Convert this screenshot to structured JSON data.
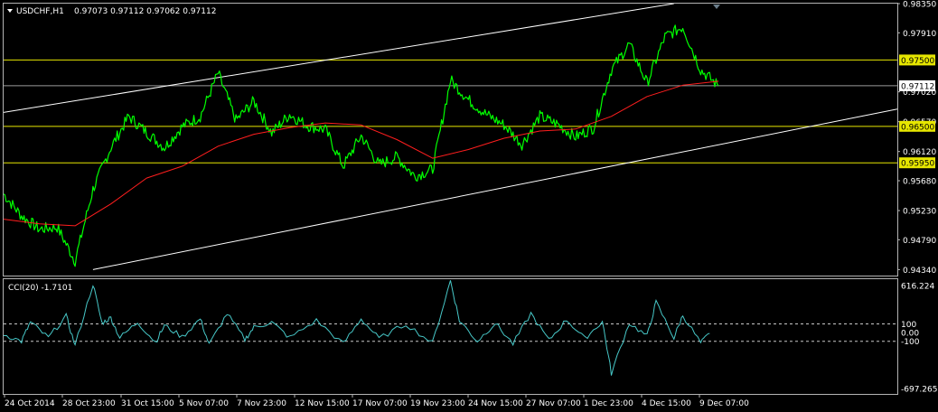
{
  "chart_data": [
    {
      "type": "line",
      "title": "USDCHF,H1",
      "ohlc_label": "0.97073 0.97112 0.97062 0.97112",
      "symbol_bar_icon": "triangle-down-icon",
      "ylim": [
        0.9425,
        0.9835
      ],
      "y_ticks": [
        "0.98350",
        "0.97910",
        "0.97020",
        "0.96570",
        "0.96120",
        "0.95680",
        "0.95230",
        "0.94790",
        "0.94340"
      ],
      "y_tick_values": [
        0.9835,
        0.9791,
        0.9702,
        0.9657,
        0.9612,
        0.9568,
        0.9523,
        0.9479,
        0.9434
      ],
      "x_ticks": [
        "24 Oct 2014",
        "28 Oct 23:00",
        "31 Oct 15:00",
        "5 Nov 07:00",
        "7 Nov 23:00",
        "12 Nov 15:00",
        "17 Nov 07:00",
        "19 Nov 23:00",
        "24 Nov 15:00",
        "27 Nov 07:00",
        "1 Dec 23:00",
        "4 Dec 15:00",
        "9 Dec 07:00"
      ],
      "x_range": [
        0,
        100
      ],
      "current_price_label": "0.97112",
      "current_price": 0.97112,
      "levels": [
        {
          "label": "0.97500",
          "value": 0.975
        },
        {
          "label": "0.96500",
          "value": 0.965
        },
        {
          "label": "0.95950",
          "value": 0.9595
        }
      ],
      "channel": [
        {
          "name": "upper",
          "x": [
            0,
            75
          ],
          "y": [
            0.9671,
            0.9835
          ]
        },
        {
          "name": "lower",
          "x": [
            10,
            100
          ],
          "y": [
            0.9434,
            0.9676
          ]
        }
      ],
      "series": [
        {
          "role": "price",
          "color": "#00ff00",
          "x": [
            0,
            2,
            4,
            6,
            8,
            10,
            12,
            14,
            16,
            18,
            20,
            22,
            24,
            26,
            28,
            30,
            32,
            34,
            36,
            38,
            40,
            42,
            44,
            46,
            48,
            50,
            52,
            54,
            56,
            58,
            60,
            62,
            64,
            66,
            68,
            70,
            72,
            74,
            76,
            78,
            80
          ],
          "y": [
            0.9548,
            0.9515,
            0.9495,
            0.9498,
            0.9447,
            0.9555,
            0.9618,
            0.9665,
            0.9641,
            0.9618,
            0.965,
            0.9665,
            0.973,
            0.9659,
            0.9688,
            0.964,
            0.9668,
            0.9651,
            0.9645,
            0.959,
            0.9636,
            0.9592,
            0.9604,
            0.9575,
            0.9585,
            0.972,
            0.969,
            0.9668,
            0.9652,
            0.9623,
            0.9665,
            0.9653,
            0.9634,
            0.9648,
            0.9735,
            0.9774,
            0.9715,
            0.9785,
            0.98,
            0.9735,
            0.9711
          ]
        },
        {
          "role": "moving average",
          "color": "#ff1e1e",
          "x": [
            0,
            4,
            8,
            12,
            16,
            20,
            24,
            28,
            32,
            36,
            40,
            44,
            48,
            52,
            56,
            60,
            64,
            68,
            72,
            76,
            80
          ],
          "y": [
            0.951,
            0.9503,
            0.95,
            0.9533,
            0.9572,
            0.959,
            0.962,
            0.9638,
            0.9648,
            0.9655,
            0.9652,
            0.963,
            0.9602,
            0.9615,
            0.9632,
            0.9643,
            0.9646,
            0.9665,
            0.9695,
            0.9712,
            0.9718
          ]
        }
      ]
    },
    {
      "type": "line",
      "title": "CCI(20) -1.7101",
      "ylim": [
        -697.2659,
        616.224
      ],
      "y_ticks": [
        "616.224",
        "100",
        "0.00",
        "-100",
        "-697.2659"
      ],
      "y_tick_values": [
        616.224,
        100,
        0,
        -100,
        -697.2659
      ],
      "levels": [
        100,
        -100
      ],
      "series": [
        {
          "name": "CCI(20)",
          "color": "#47c8c8",
          "x": [
            0,
            2,
            3,
            5,
            7,
            8,
            10,
            11,
            12,
            13,
            15,
            17,
            18,
            20,
            22,
            23,
            25,
            27,
            28,
            30,
            32,
            35,
            38,
            40,
            42,
            45,
            48,
            50,
            51,
            53,
            55,
            57,
            59,
            61,
            63,
            65,
            67,
            68,
            70,
            72,
            73,
            75,
            76,
            78,
            79
          ],
          "y": [
            -20,
            -100,
            120,
            -60,
            190,
            -150,
            560,
            110,
            170,
            -60,
            120,
            -110,
            80,
            -50,
            160,
            -140,
            220,
            -80,
            60,
            120,
            -60,
            140,
            -130,
            160,
            -70,
            100,
            -120,
            600,
            140,
            -100,
            110,
            -130,
            220,
            -90,
            150,
            -70,
            130,
            -470,
            110,
            -40,
            350,
            -60,
            200,
            -120,
            -10
          ]
        }
      ]
    }
  ]
}
